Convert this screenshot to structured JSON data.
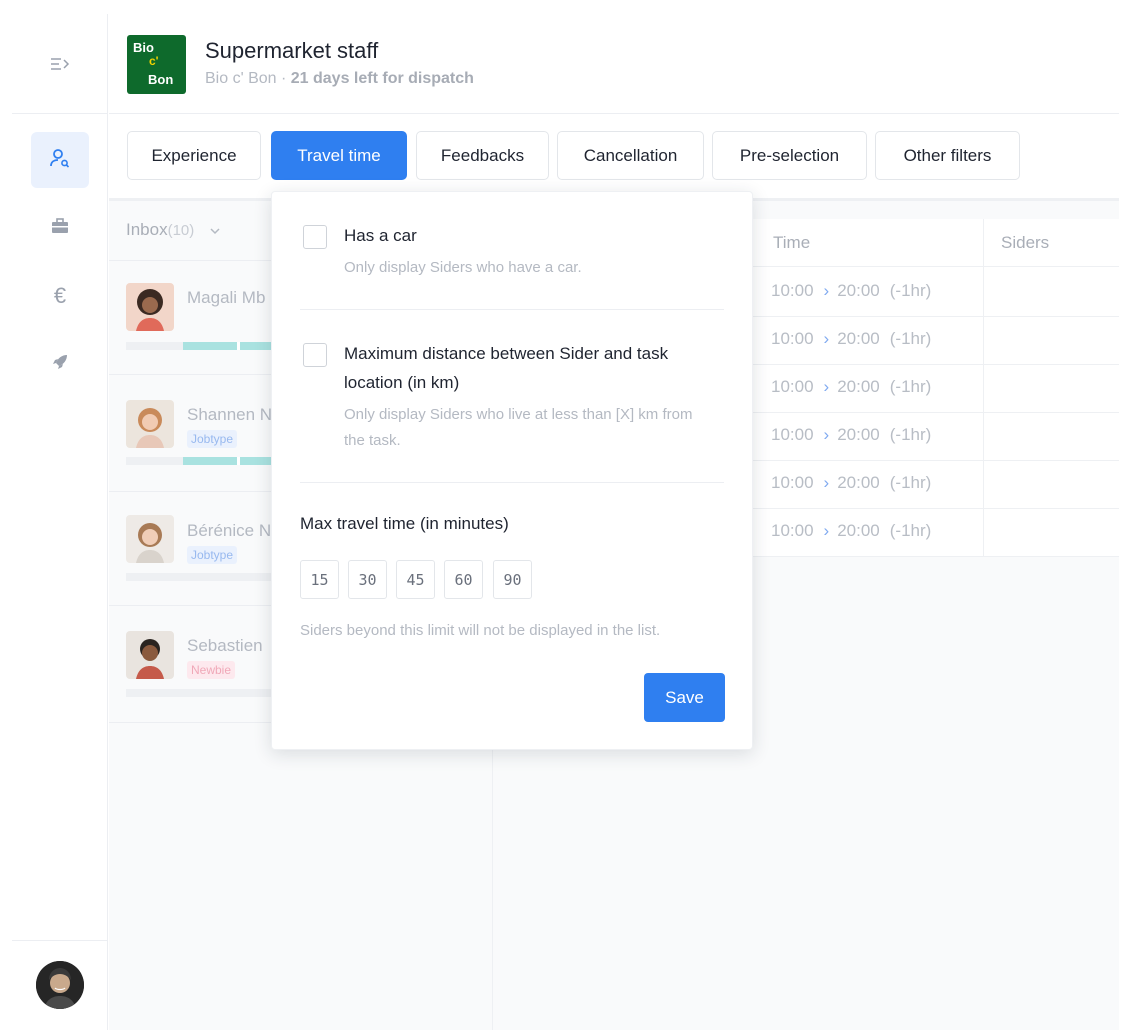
{
  "header": {
    "logo": {
      "line1": "Bio",
      "line2": "c'",
      "line3": "Bon"
    },
    "title": "Supermarket staff",
    "subtitle_company": "Bio c' Bon ·",
    "subtitle_days": "21 days left for dispatch"
  },
  "sidebar": {
    "toggle_icon": "collapse-menu-icon",
    "items": [
      {
        "name": "users-search",
        "icon": "user-search-icon",
        "active": true
      },
      {
        "name": "jobs",
        "icon": "briefcase-icon",
        "active": false
      },
      {
        "name": "payments",
        "icon": "euro-icon",
        "active": false
      },
      {
        "name": "launch",
        "icon": "rocket-icon",
        "active": false
      }
    ]
  },
  "tabs": [
    {
      "label": "Experience",
      "active": false
    },
    {
      "label": "Travel time",
      "active": true
    },
    {
      "label": "Feedbacks",
      "active": false
    },
    {
      "label": "Cancellation",
      "active": false
    },
    {
      "label": "Pre-selection",
      "active": false
    },
    {
      "label": "Other filters",
      "active": false
    }
  ],
  "inbox": {
    "label": "Inbox",
    "count": "(10)",
    "people": [
      {
        "name": "Magali Mb",
        "badge": "",
        "badge_type": "",
        "progress": 0.6
      },
      {
        "name": "Shannen N",
        "badge": "Jobtype",
        "badge_type": "job",
        "progress": 0.6
      },
      {
        "name": "Bérénice N",
        "badge": "Jobtype",
        "badge_type": "job",
        "progress": 0
      },
      {
        "name": "Sebastien",
        "badge": "Newbie",
        "badge_type": "new",
        "progress": 0
      }
    ]
  },
  "table": {
    "headers": [
      "Time",
      "Siders"
    ],
    "rows": [
      {
        "start": "10:00",
        "end": "20:00",
        "diff": "(-1hr)"
      },
      {
        "start": "10:00",
        "end": "20:00",
        "diff": "(-1hr)"
      },
      {
        "start": "10:00",
        "end": "20:00",
        "diff": "(-1hr)"
      },
      {
        "start": "10:00",
        "end": "20:00",
        "diff": "(-1hr)"
      },
      {
        "start": "10:00",
        "end": "20:00",
        "diff": "(-1hr)"
      },
      {
        "start": "10:00",
        "end": "20:00",
        "diff": "(-1hr)"
      }
    ]
  },
  "popover": {
    "options": [
      {
        "title": "Has a car",
        "desc": "Only display Siders who have a car.",
        "checked": false
      },
      {
        "title": "Maximum distance between Sider and task location (in km)",
        "desc": "Only display Siders who live at less than [X] km from the task.",
        "checked": false
      }
    ],
    "travel_title": "Max travel time (in minutes)",
    "chips": [
      "15",
      "30",
      "45",
      "60",
      "90"
    ],
    "hint": "Siders beyond this limit will not be displayed in the list.",
    "save_label": "Save"
  },
  "colors": {
    "accent": "#2f7ff0",
    "logo_bg": "#0e6a2c"
  }
}
